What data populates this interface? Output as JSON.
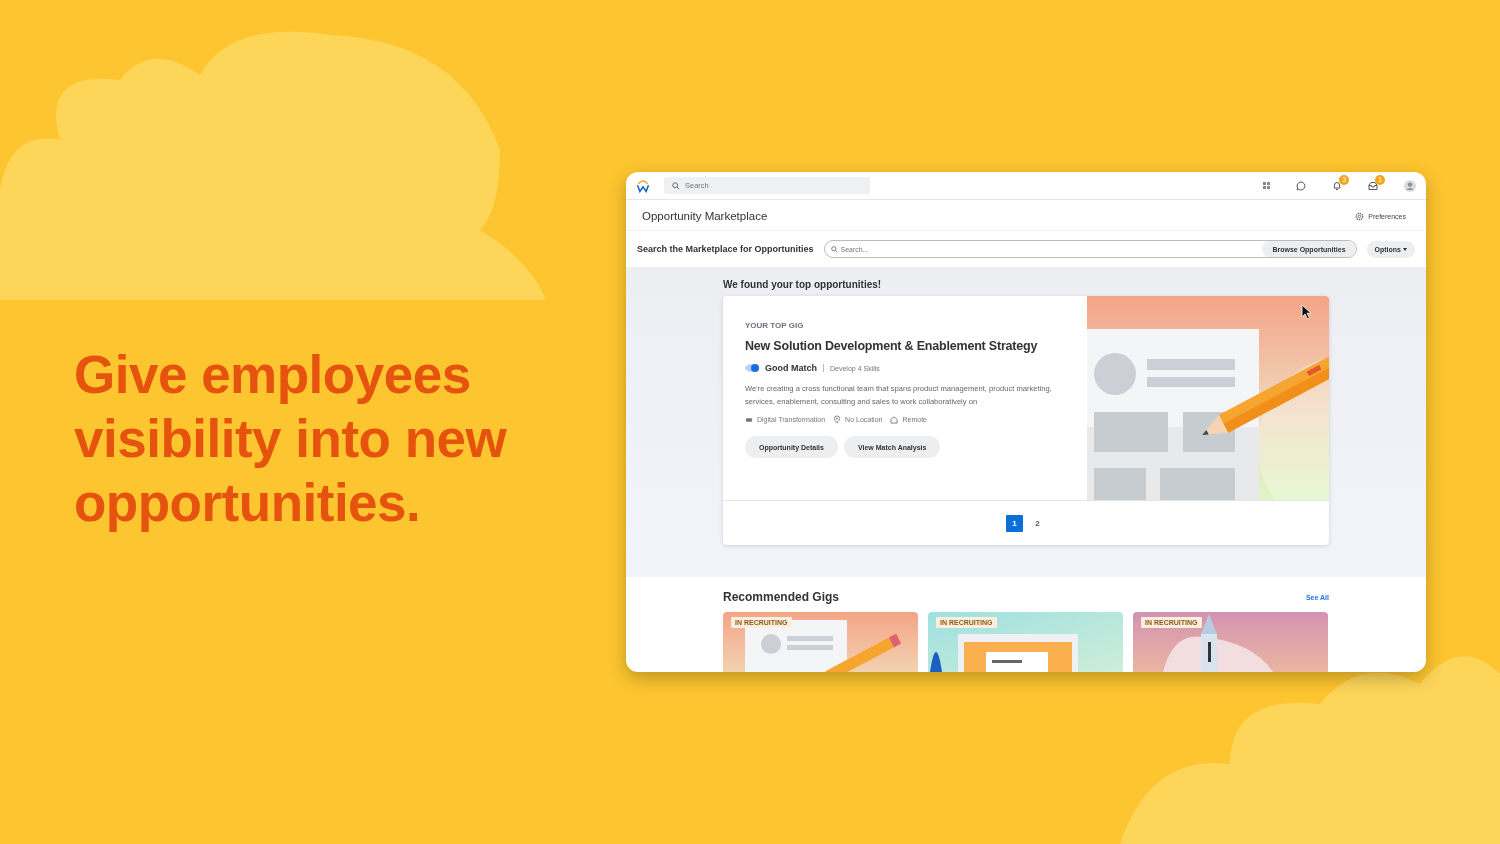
{
  "headline": "Give employees visibility into new opportunities.",
  "topbar": {
    "search_placeholder": "Search",
    "notifications": [
      {
        "kind": "bell",
        "count": "3"
      },
      {
        "kind": "inbox",
        "count": "1"
      }
    ]
  },
  "page_title": "Opportunity Marketplace",
  "preferences": "Preferences",
  "marketplace_search": {
    "label": "Search the Marketplace for Opportunities",
    "placeholder": "Search...",
    "browse_button": "Browse Opportunities",
    "options_button": "Options"
  },
  "top_opportunities": {
    "heading": "We found your top opportunities!",
    "card": {
      "eyebrow": "YOUR TOP GIG",
      "title": "New Solution Development & Enablement Strategy",
      "match": "Good Match",
      "skills": "Develop 4 Skills",
      "description": "We're creating a cross functional team that spans product management, product marketing, services, enablement, consulting and sales to work collaboratively on",
      "tags": [
        {
          "kind": "category",
          "text": "Digital Transformation"
        },
        {
          "kind": "location",
          "text": "No Location"
        },
        {
          "kind": "remote",
          "text": "Remote"
        }
      ],
      "buttons": [
        "Opportunity Details",
        "View Match Analysis"
      ]
    },
    "pages": [
      {
        "label": "1",
        "selected": true
      },
      {
        "label": "2",
        "selected": false
      }
    ]
  },
  "recommended": {
    "heading": "Recommended Gigs",
    "see_all": "See All",
    "gigs": [
      {
        "status": "IN RECRUITING",
        "kind": "pencil"
      },
      {
        "status": "IN RECRUITING",
        "kind": "browser"
      },
      {
        "status": "IN RECRUITING",
        "kind": "tower"
      }
    ]
  }
}
